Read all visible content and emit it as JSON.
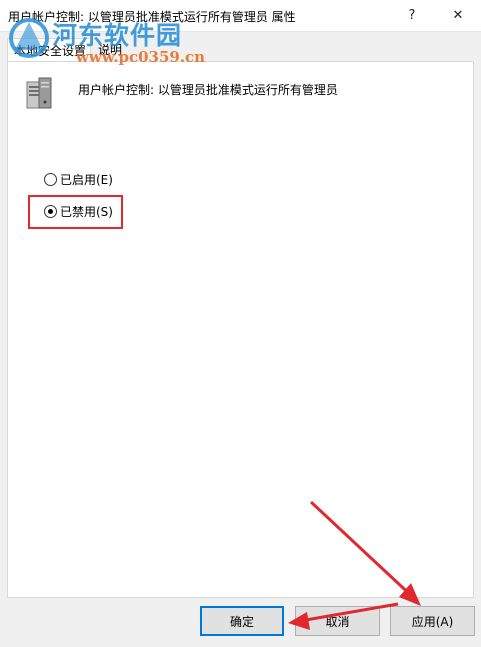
{
  "window": {
    "title": "用户帐户控制: 以管理员批准模式运行所有管理员 属性",
    "help_glyph": "?",
    "close_glyph": "✕"
  },
  "tabs": [
    {
      "label": "本地安全设置",
      "selected": true
    },
    {
      "label": "说明",
      "selected": false
    }
  ],
  "policy": {
    "name": "用户帐户控制: 以管理员批准模式运行所有管理员",
    "icon": "server-policy-icon"
  },
  "options": [
    {
      "label": "已启用(E)",
      "checked": false
    },
    {
      "label": "已禁用(S)",
      "checked": true
    }
  ],
  "buttons": {
    "ok": "确定",
    "cancel": "取消",
    "apply": "应用(A)"
  },
  "watermark": {
    "name": "河东软件园",
    "url": "www.pc0359.cn"
  },
  "colors": {
    "highlight": "#e0282e",
    "arrow": "#e0282e",
    "default_button_border": "#0078d7",
    "watermark_blue": "#2a8fd6",
    "watermark_orange": "#e8702a"
  }
}
